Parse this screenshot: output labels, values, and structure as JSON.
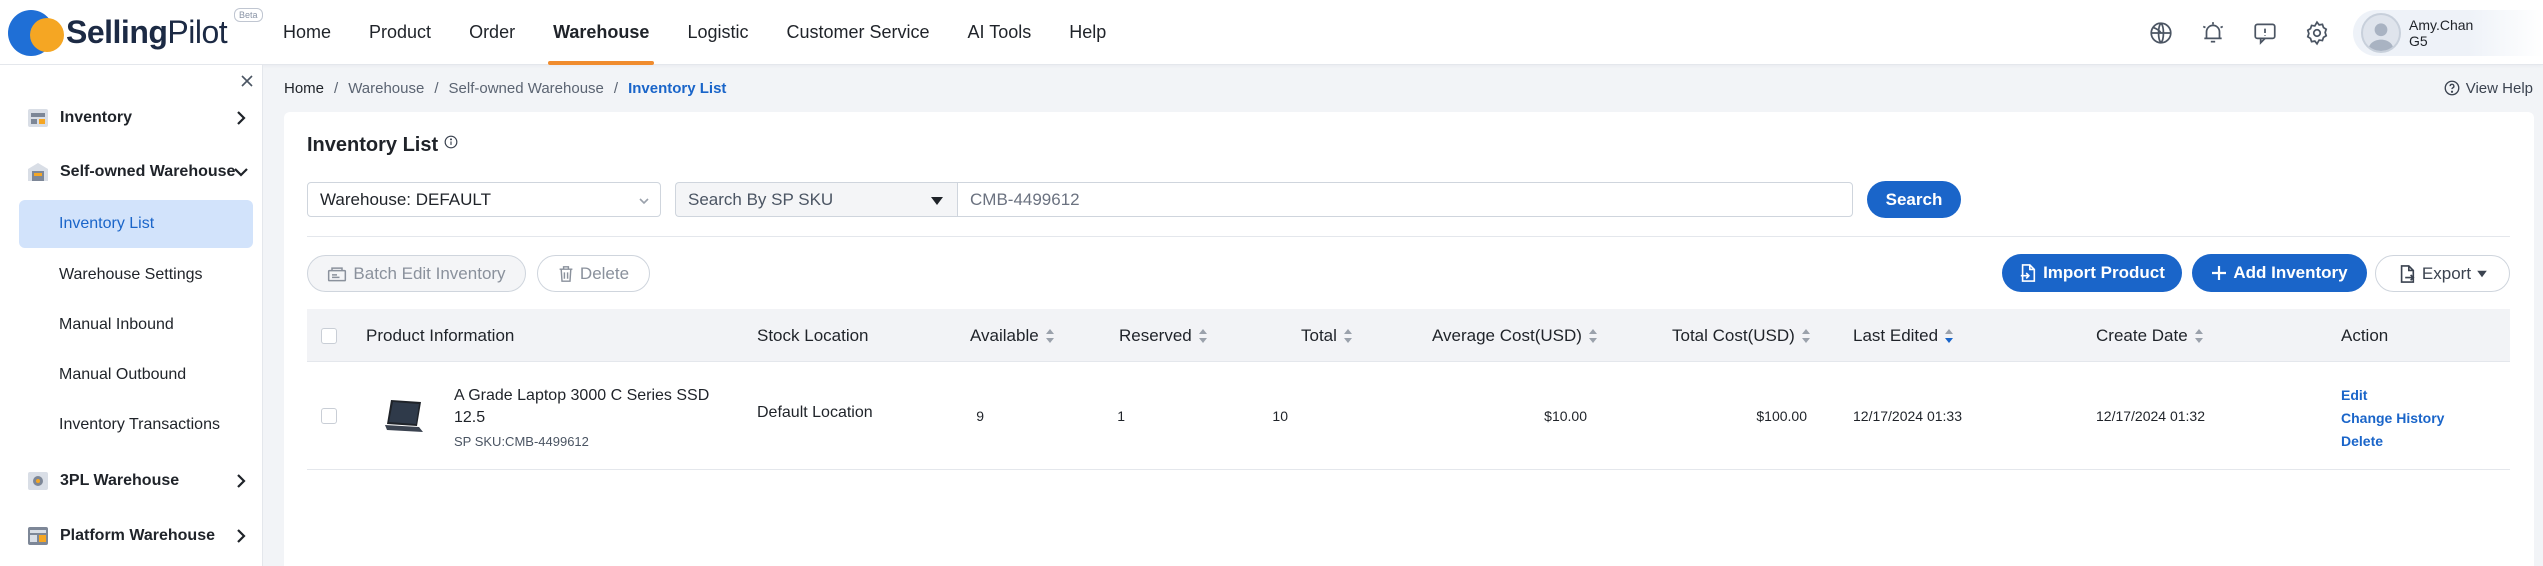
{
  "app": {
    "logo_brand": "Selling",
    "logo_light": "Pilot",
    "beta_badge": "Beta"
  },
  "nav": {
    "items": [
      "Home",
      "Product",
      "Order",
      "Warehouse",
      "Logistic",
      "Customer Service",
      "AI Tools",
      "Help"
    ],
    "active": "Warehouse"
  },
  "header_icons": [
    "globe-icon",
    "bell-icon",
    "message-icon",
    "gear-icon"
  ],
  "user": {
    "name": "Amy.Chan",
    "code": "G5"
  },
  "sidebar": {
    "groups": [
      {
        "label": "Inventory",
        "icon": "inventory-icon",
        "expanded": false
      },
      {
        "label": "Self-owned Warehouse",
        "icon": "warehouse-icon",
        "expanded": true
      },
      {
        "label": "3PL Warehouse",
        "icon": "third-party-warehouse-icon",
        "expanded": false
      },
      {
        "label": "Platform Warehouse",
        "icon": "platform-warehouse-icon",
        "expanded": false
      }
    ],
    "sub_items": [
      "Inventory List",
      "Warehouse Settings",
      "Manual Inbound",
      "Manual Outbound",
      "Inventory Transactions"
    ],
    "active_sub": "Inventory List"
  },
  "breadcrumb": [
    "Home",
    "Warehouse",
    "Self-owned Warehouse",
    "Inventory List"
  ],
  "view_help": "View Help",
  "page": {
    "title": "Inventory List"
  },
  "filters": {
    "warehouse": "Warehouse: DEFAULT",
    "search_type": "Search By SP SKU",
    "search_value": "CMB-4499612",
    "search_button": "Search"
  },
  "toolbar": {
    "batch_edit": "Batch Edit Inventory",
    "delete": "Delete",
    "import": "Import Product",
    "add": "Add Inventory",
    "export": "Export"
  },
  "table": {
    "columns": [
      "Product Information",
      "Stock Location",
      "Available",
      "Reserved",
      "Total",
      "Average Cost(USD)",
      "Total Cost(USD)",
      "Last Edited",
      "Create Date",
      "Action"
    ],
    "rows": [
      {
        "product_name": "A Grade Laptop 3000 C Series SSD 12.5",
        "sku": "SP SKU:CMB-4499612",
        "location": "Default Location",
        "available": "9",
        "reserved": "1",
        "total": "10",
        "avg_cost": "$10.00",
        "total_cost": "$100.00",
        "last_edited": "12/17/2024 01:33",
        "create_date": "12/17/2024 01:32",
        "actions": [
          "Edit",
          "Change History",
          "Delete"
        ]
      }
    ]
  },
  "colors": {
    "primary": "#1a65c9",
    "nav_active": "#f08c2e",
    "sidebar_active_bg": "#d2e3fb"
  }
}
